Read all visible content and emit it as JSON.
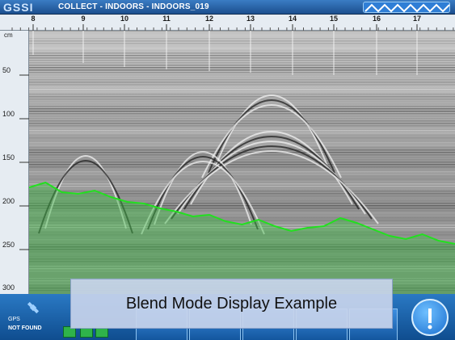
{
  "header": {
    "logo": "GSSI",
    "title": "COLLECT - INDOORS - INDOORS_019"
  },
  "distance_ruler": {
    "labels": [
      "8",
      "9",
      "10",
      "11",
      "12",
      "13",
      "14",
      "15",
      "16",
      "17"
    ]
  },
  "depth_ruler": {
    "unit": "cm",
    "labels": [
      "50",
      "100",
      "150",
      "200",
      "250",
      "300"
    ]
  },
  "gps": {
    "label": "GPS",
    "status": "NOT FOUND"
  },
  "caption": {
    "text": "Blend Mode Display Example"
  },
  "colors": {
    "header": "#1c4f8e",
    "toolbar": "#0f4d8f",
    "overlay_line": "#22e01f",
    "overlay_fill": "#3dbb45"
  },
  "icons": [
    "gps-satellite-icon",
    "waveform-icon",
    "stop-button",
    "play-button",
    "download-button",
    "menu-button",
    "power-button",
    "info-button"
  ]
}
